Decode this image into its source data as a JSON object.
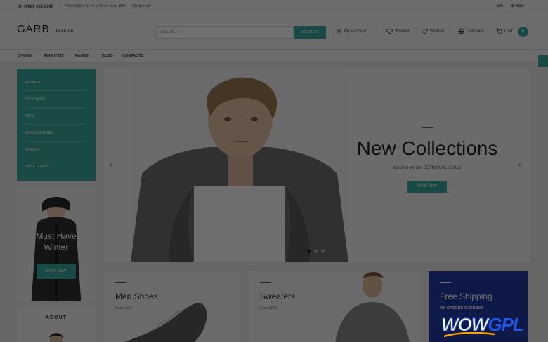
{
  "topbar": {
    "phone": "+0000 000 0000",
    "promo": "Free delivery on orders over $99 — Shop now",
    "language": "EN",
    "currency": "$ USD"
  },
  "header": {
    "logo": "GARB",
    "logo_tagline": "FASHION",
    "search_placeholder": "Search...",
    "search_button": "SEARCH",
    "links": [
      {
        "label": "My Account",
        "icon": "user-icon"
      },
      {
        "label": "Wishlist",
        "icon": "heart-icon"
      },
      {
        "label": "Wishlist",
        "icon": "heart-outline-icon"
      },
      {
        "label": "Compare",
        "icon": "globe-icon"
      },
      {
        "label": "Cart",
        "icon": "cart-icon"
      }
    ],
    "cart_count": "0"
  },
  "nav": [
    "STORE",
    "ABOUT US",
    "PAGES",
    "BLOG",
    "CONTACTS"
  ],
  "categories": [
    "WOMEN",
    "CLOTHING",
    "MEN",
    "ACCESSORIES",
    "SHOES",
    "SALE ITEMS"
  ],
  "promo_winter": {
    "title_line1": "Must Have",
    "title_line2": "Winter",
    "button": "SHOP NOW"
  },
  "about": {
    "label": "ABOUT"
  },
  "slider": {
    "title": "New Collections",
    "subtitle": "autumn-winter EDITORIAL / 2018",
    "button": "SHOP NOW",
    "prev": "‹",
    "next": "›",
    "active_slide": 1,
    "slide_count": 3
  },
  "banners": [
    {
      "title": "Men Shoes",
      "sub": "From $19"
    },
    {
      "title": "Sweaters",
      "sub": "From $29"
    },
    {
      "title": "Free Shipping",
      "sub": "ON ORDERS OVER $99"
    }
  ],
  "watermark": {
    "part1": "WOW",
    "part2": "GPL"
  },
  "colors": {
    "accent": "#3ca8a0",
    "blue": "#233aa5"
  }
}
